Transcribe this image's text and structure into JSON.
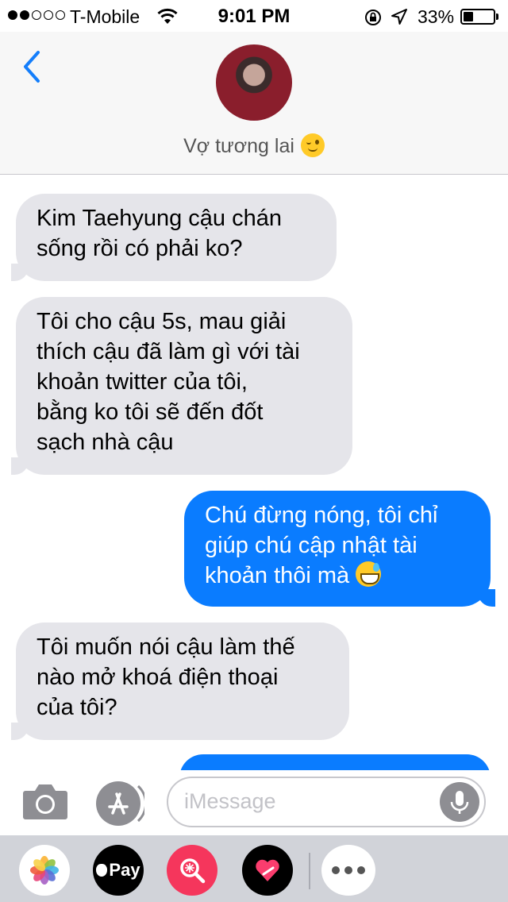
{
  "status_bar": {
    "carrier": "T-Mobile",
    "time": "9:01 PM",
    "battery_percent": "33%",
    "battery_level": 0.33,
    "signal_bars": 2,
    "signal_total": 5,
    "icons": [
      "wifi-icon",
      "rotation-lock-icon",
      "location-arrow-icon",
      "battery-icon"
    ]
  },
  "header": {
    "back_icon": "chevron-left-icon",
    "contact_name": "Vợ tương lai",
    "contact_emoji": "winking-face-emoji"
  },
  "messages": [
    {
      "direction": "incoming",
      "lines": [
        "Kim Taehyung cậu chán",
        "sống rồi có phải ko?"
      ]
    },
    {
      "direction": "incoming",
      "lines": [
        "Tôi cho cậu 5s, mau giải",
        "thích cậu đã làm gì với tài",
        "khoản twitter của tôi,",
        "bằng ko tôi sẽ đến đốt",
        "sạch nhà cậu"
      ]
    },
    {
      "direction": "outgoing",
      "lines": [
        "Chú đừng nóng, tôi chỉ",
        "giúp chú cập nhật tài",
        "khoản thôi mà"
      ],
      "emoji": "grinning-sweat-emoji"
    },
    {
      "direction": "incoming",
      "lines": [
        "Tôi muốn nói cậu làm thế",
        "nào mở khoá điện thoại",
        "của tôi?"
      ]
    }
  ],
  "input_bar": {
    "placeholder": "iMessage",
    "camera_icon": "camera-icon",
    "appstore_icon": "app-store-icon",
    "mic_icon": "microphone-icon"
  },
  "app_drawer": {
    "apps": [
      "photos-icon",
      "apple-pay-icon",
      "image-search-icon",
      "digital-touch-icon",
      "more-apps-icon"
    ],
    "pay_label": "Pay"
  },
  "colors": {
    "outgoing_bubble": "#0a7cff",
    "incoming_bubble": "#e5e5ea",
    "accent": "#147efb"
  }
}
